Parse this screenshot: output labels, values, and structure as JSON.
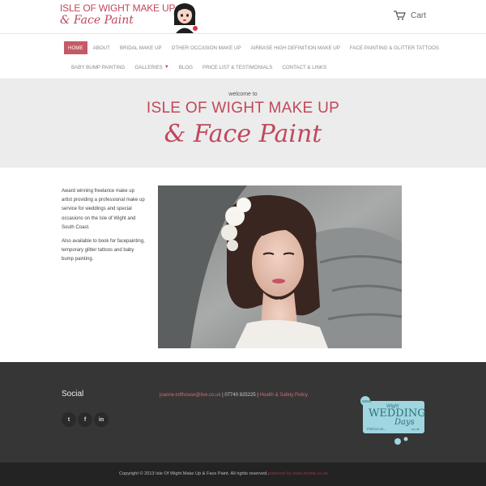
{
  "header": {
    "logo_line1": "ISLE OF WIGHT MAKE UP",
    "logo_line2": "& Face Paint",
    "cart_label": "Cart"
  },
  "nav": {
    "row1": [
      {
        "label": "HOME",
        "active": true
      },
      {
        "label": "ABOUT"
      },
      {
        "label": "BRIDAL MAKE UP"
      },
      {
        "label": "OTHER OCCASION MAKE UP"
      },
      {
        "label": "AIRBASE HIGH DEFINITION MAKE UP"
      },
      {
        "label": "FACE PAINTING & GLITTER TATTOOS"
      }
    ],
    "row2": [
      {
        "label": "BABY BUMP PAINTING"
      },
      {
        "label": "GALLERIES",
        "dropdown": true
      },
      {
        "label": "BLOG"
      },
      {
        "label": "PRICE LIST & TESTIMONIALS"
      },
      {
        "label": "CONTACT & LINKS"
      }
    ]
  },
  "hero": {
    "welcome": "welcome to",
    "title_line1": "ISLE OF WIGHT MAKE UP",
    "title_line2": "& Face Paint"
  },
  "intro": {
    "p1": "Award winning freelance make up artist providing a professional make up service for weddings and special occasions on the Isle of Wight and South Coast.",
    "p2": "Also available to book for facepainting, temporary glitter tattoos and baby bump painting."
  },
  "footer": {
    "social_title": "Social",
    "social_icons": [
      "twitter-icon",
      "facebook-icon",
      "linkedin-icon"
    ],
    "social_glyphs": [
      "t",
      "f",
      "in"
    ],
    "email": "joanne-lofthouse@live.co.uk",
    "separator1": " | ",
    "phone": "07740 825225",
    "separator2": " | ",
    "policy": "Health & Safety Policy",
    "badge_line1": "www.",
    "badge_line2": "Wight",
    "badge_line3": "WEDDING",
    "badge_line4": "Days",
    "badge_line5": ".co.uk",
    "badge_line6": "Find us at..."
  },
  "bottom": {
    "copyright": "Copyright © 2013 Isle Of Wight Make Up & Face Paint. All rights reserved.",
    "powered": "powered by www.mrsite.co.uk"
  },
  "colors": {
    "accent": "#c0485a",
    "footer_bg": "#363636",
    "badge": "#9fd6df"
  }
}
